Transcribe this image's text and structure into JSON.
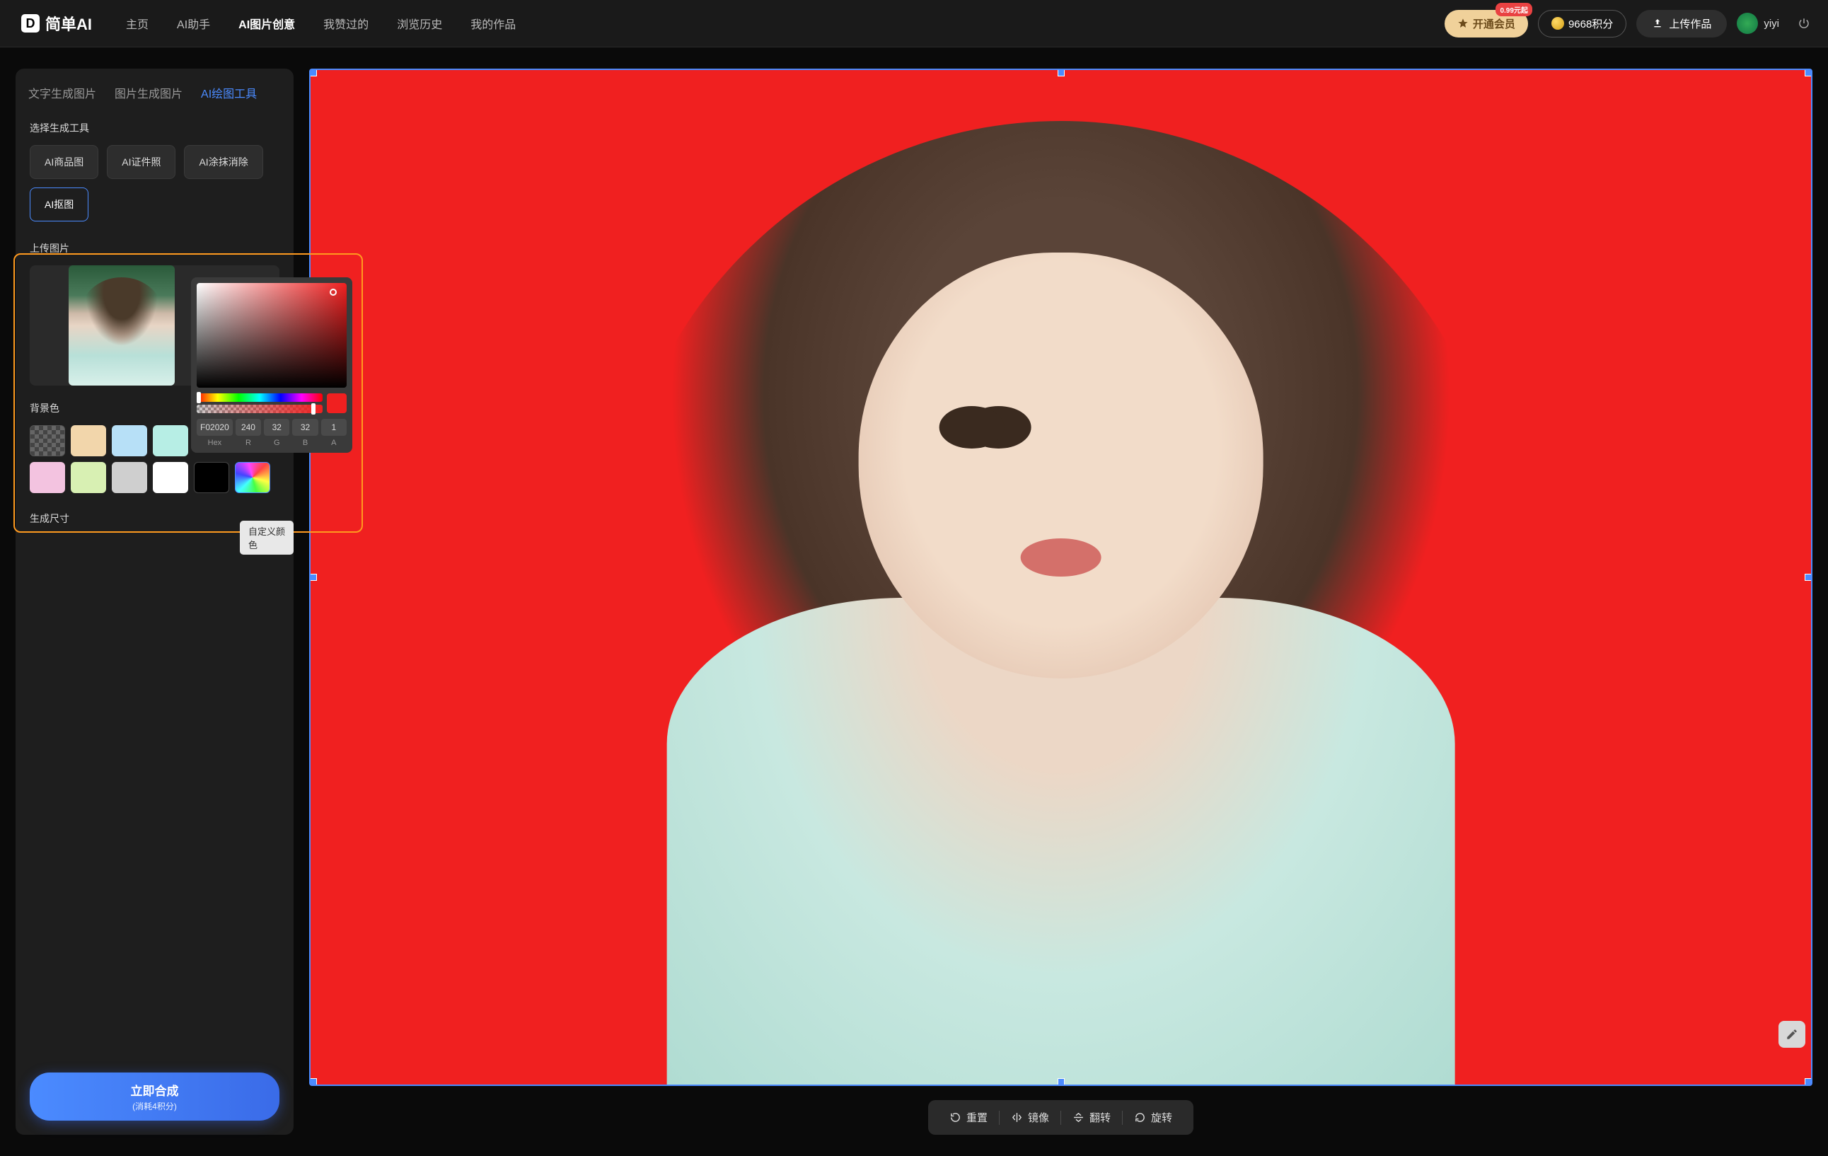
{
  "header": {
    "brand": "简单AI",
    "nav": [
      "主页",
      "AI助手",
      "AI图片创意",
      "我赞过的",
      "浏览历史",
      "我的作品"
    ],
    "active_nav": 2,
    "vip_button": "开通会员",
    "vip_badge": "0.99元起",
    "points": "9668积分",
    "upload_button": "上传作品",
    "username": "yiyi"
  },
  "sidebar": {
    "tabs": [
      "文字生成图片",
      "图片生成图片",
      "AI绘图工具"
    ],
    "active_tab": 2,
    "section_tools_title": "选择生成工具",
    "tools": [
      "AI商品图",
      "AI证件照",
      "AI涂抹消除",
      "AI抠图"
    ],
    "active_tool": 3,
    "section_upload_title": "上传图片",
    "section_bg_title": "背景色",
    "swatches_row1": [
      "transparent",
      "#f2d6ab",
      "#b7e0f7",
      "#b7eee5",
      "#f05a5a"
    ],
    "swatches_row2": [
      "#f3c3e0",
      "#d8f0b3",
      "#cfcfcf",
      "#ffffff",
      "#000000",
      "rainbow"
    ],
    "section_size_title": "生成尺寸",
    "custom_color_tooltip": "自定义颜色",
    "generate": {
      "title": "立即合成",
      "subtitle": "(消耗4积分)"
    }
  },
  "color_picker": {
    "hex": "F02020",
    "r": "240",
    "g": "32",
    "b": "32",
    "a": "1",
    "labels": {
      "hex": "Hex",
      "r": "R",
      "g": "G",
      "b": "B",
      "a": "A"
    }
  },
  "canvas": {
    "bg_color": "#f02020",
    "toolbar": {
      "reset": "重置",
      "mirror": "镜像",
      "flip": "翻转",
      "rotate": "旋转"
    }
  }
}
